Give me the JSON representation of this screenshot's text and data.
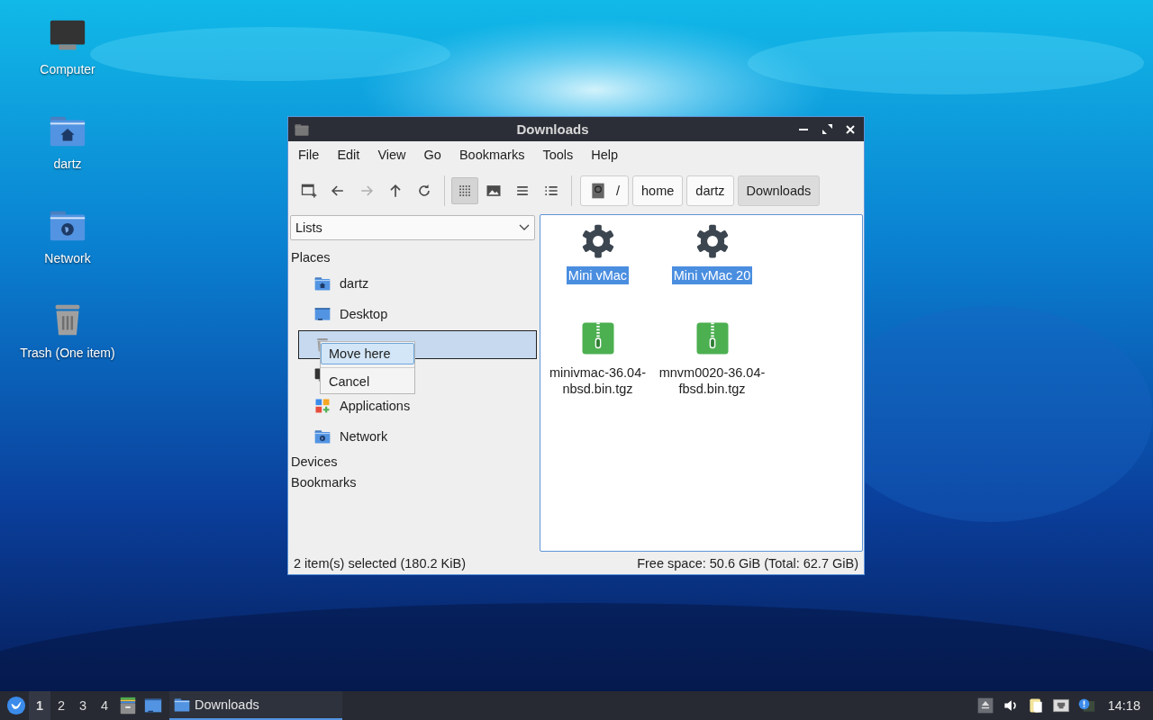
{
  "desktop": {
    "icons": [
      {
        "kind": "computer",
        "label": "Computer"
      },
      {
        "kind": "home-folder",
        "label": "dartz"
      },
      {
        "kind": "network-folder",
        "label": "Network"
      },
      {
        "kind": "trash",
        "label": "Trash (One item)"
      }
    ]
  },
  "window": {
    "title": "Downloads",
    "menu": [
      "File",
      "Edit",
      "View",
      "Go",
      "Bookmarks",
      "Tools",
      "Help"
    ],
    "nav_buttons": [
      {
        "kind": "new-window",
        "disabled": false
      },
      {
        "kind": "back",
        "disabled": false
      },
      {
        "kind": "forward",
        "disabled": true
      },
      {
        "kind": "up",
        "disabled": false
      },
      {
        "kind": "reload",
        "disabled": false
      }
    ],
    "view_buttons": [
      {
        "kind": "icons",
        "selected": true
      },
      {
        "kind": "thumbnails",
        "selected": false
      },
      {
        "kind": "compact",
        "selected": false
      },
      {
        "kind": "details",
        "selected": false
      }
    ],
    "path": [
      {
        "kind": "root",
        "label": "/",
        "selected": false
      },
      {
        "kind": "dir",
        "label": "home",
        "selected": false
      },
      {
        "kind": "dir",
        "label": "dartz",
        "selected": false
      },
      {
        "kind": "dir",
        "label": "Downloads",
        "selected": true
      }
    ],
    "side_pane": {
      "mode": "Lists",
      "sections": [
        {
          "label": "Places",
          "items": [
            {
              "kind": "home-folder",
              "label": "dartz",
              "selected": false
            },
            {
              "kind": "desktop",
              "label": "Desktop",
              "selected": false
            },
            {
              "kind": "trash",
              "selected": true
            },
            {
              "kind": "computer",
              "selected": false
            },
            {
              "kind": "applications",
              "label": "Applications",
              "selected": false
            },
            {
              "kind": "network-folder",
              "label": "Network",
              "selected": false
            }
          ]
        },
        {
          "label": "Devices"
        },
        {
          "label": "Bookmarks"
        }
      ]
    },
    "files": [
      {
        "kind": "executable",
        "label": "Mini vMac",
        "selected": true
      },
      {
        "kind": "executable",
        "label": "Mini vMac 20",
        "selected": true
      },
      {
        "kind": "archive",
        "label": "minivmac-36.04-nbsd.bin.tgz",
        "selected": false
      },
      {
        "kind": "archive",
        "label": "mnvm0020-36.04-fbsd.bin.tgz",
        "selected": false
      }
    ],
    "status_bar": {
      "selection": "2 item(s) selected (180.2 KiB)",
      "free_space": "Free space: 50.6 GiB (Total: 62.7 GiB)"
    }
  },
  "context_menu": {
    "items": [
      {
        "label": "Move here",
        "selected": true
      },
      {
        "label": "Cancel",
        "selected": false
      }
    ]
  },
  "taskbar": {
    "workspaces": [
      {
        "label": "1",
        "selected": true
      },
      {
        "label": "2",
        "selected": false
      },
      {
        "label": "3",
        "selected": false
      },
      {
        "label": "4",
        "selected": false
      }
    ],
    "launchers": [
      {
        "kind": "file-cabinet"
      },
      {
        "kind": "desktop"
      }
    ],
    "tasks": [
      {
        "label": "Downloads",
        "selected": true
      }
    ],
    "tray": [
      {
        "kind": "eject"
      },
      {
        "kind": "volume"
      },
      {
        "kind": "clipboard"
      },
      {
        "kind": "ethernet"
      },
      {
        "kind": "notification"
      }
    ],
    "clock": "14:18"
  }
}
